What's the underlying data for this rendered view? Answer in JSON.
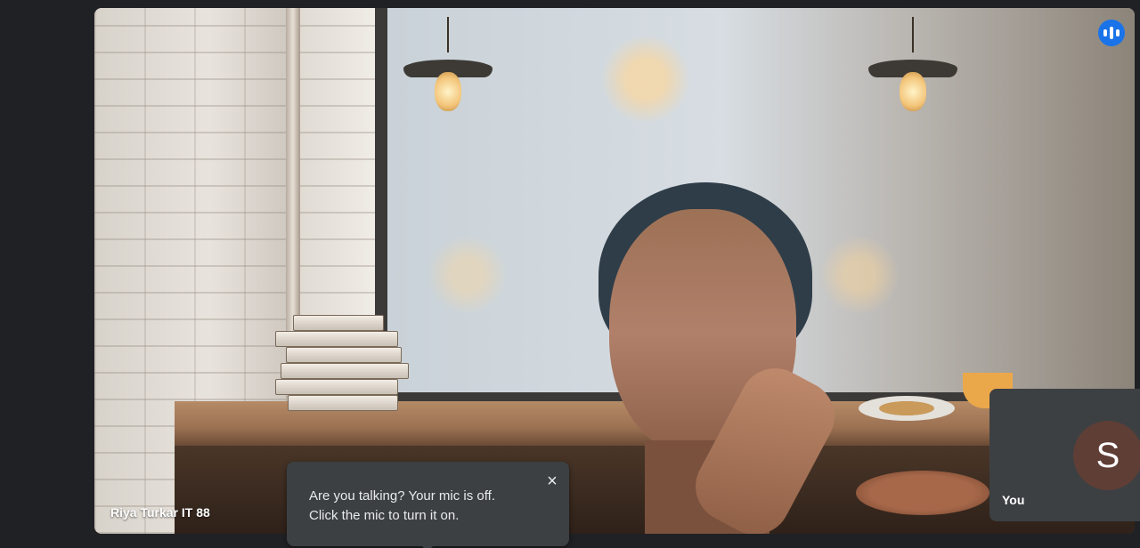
{
  "main_tile": {
    "participant_name": "Riya Turkar IT 88"
  },
  "speaking_indicator": {
    "icon": "audio-level-icon",
    "color": "#1a73e8"
  },
  "self_tile": {
    "avatar_letter": "S",
    "avatar_color": "#5f3e36",
    "label": "You"
  },
  "mic_toast": {
    "line1": "Are you talking? Your mic is off.",
    "line2": "Click the mic to turn it on.",
    "close_icon": "×"
  }
}
